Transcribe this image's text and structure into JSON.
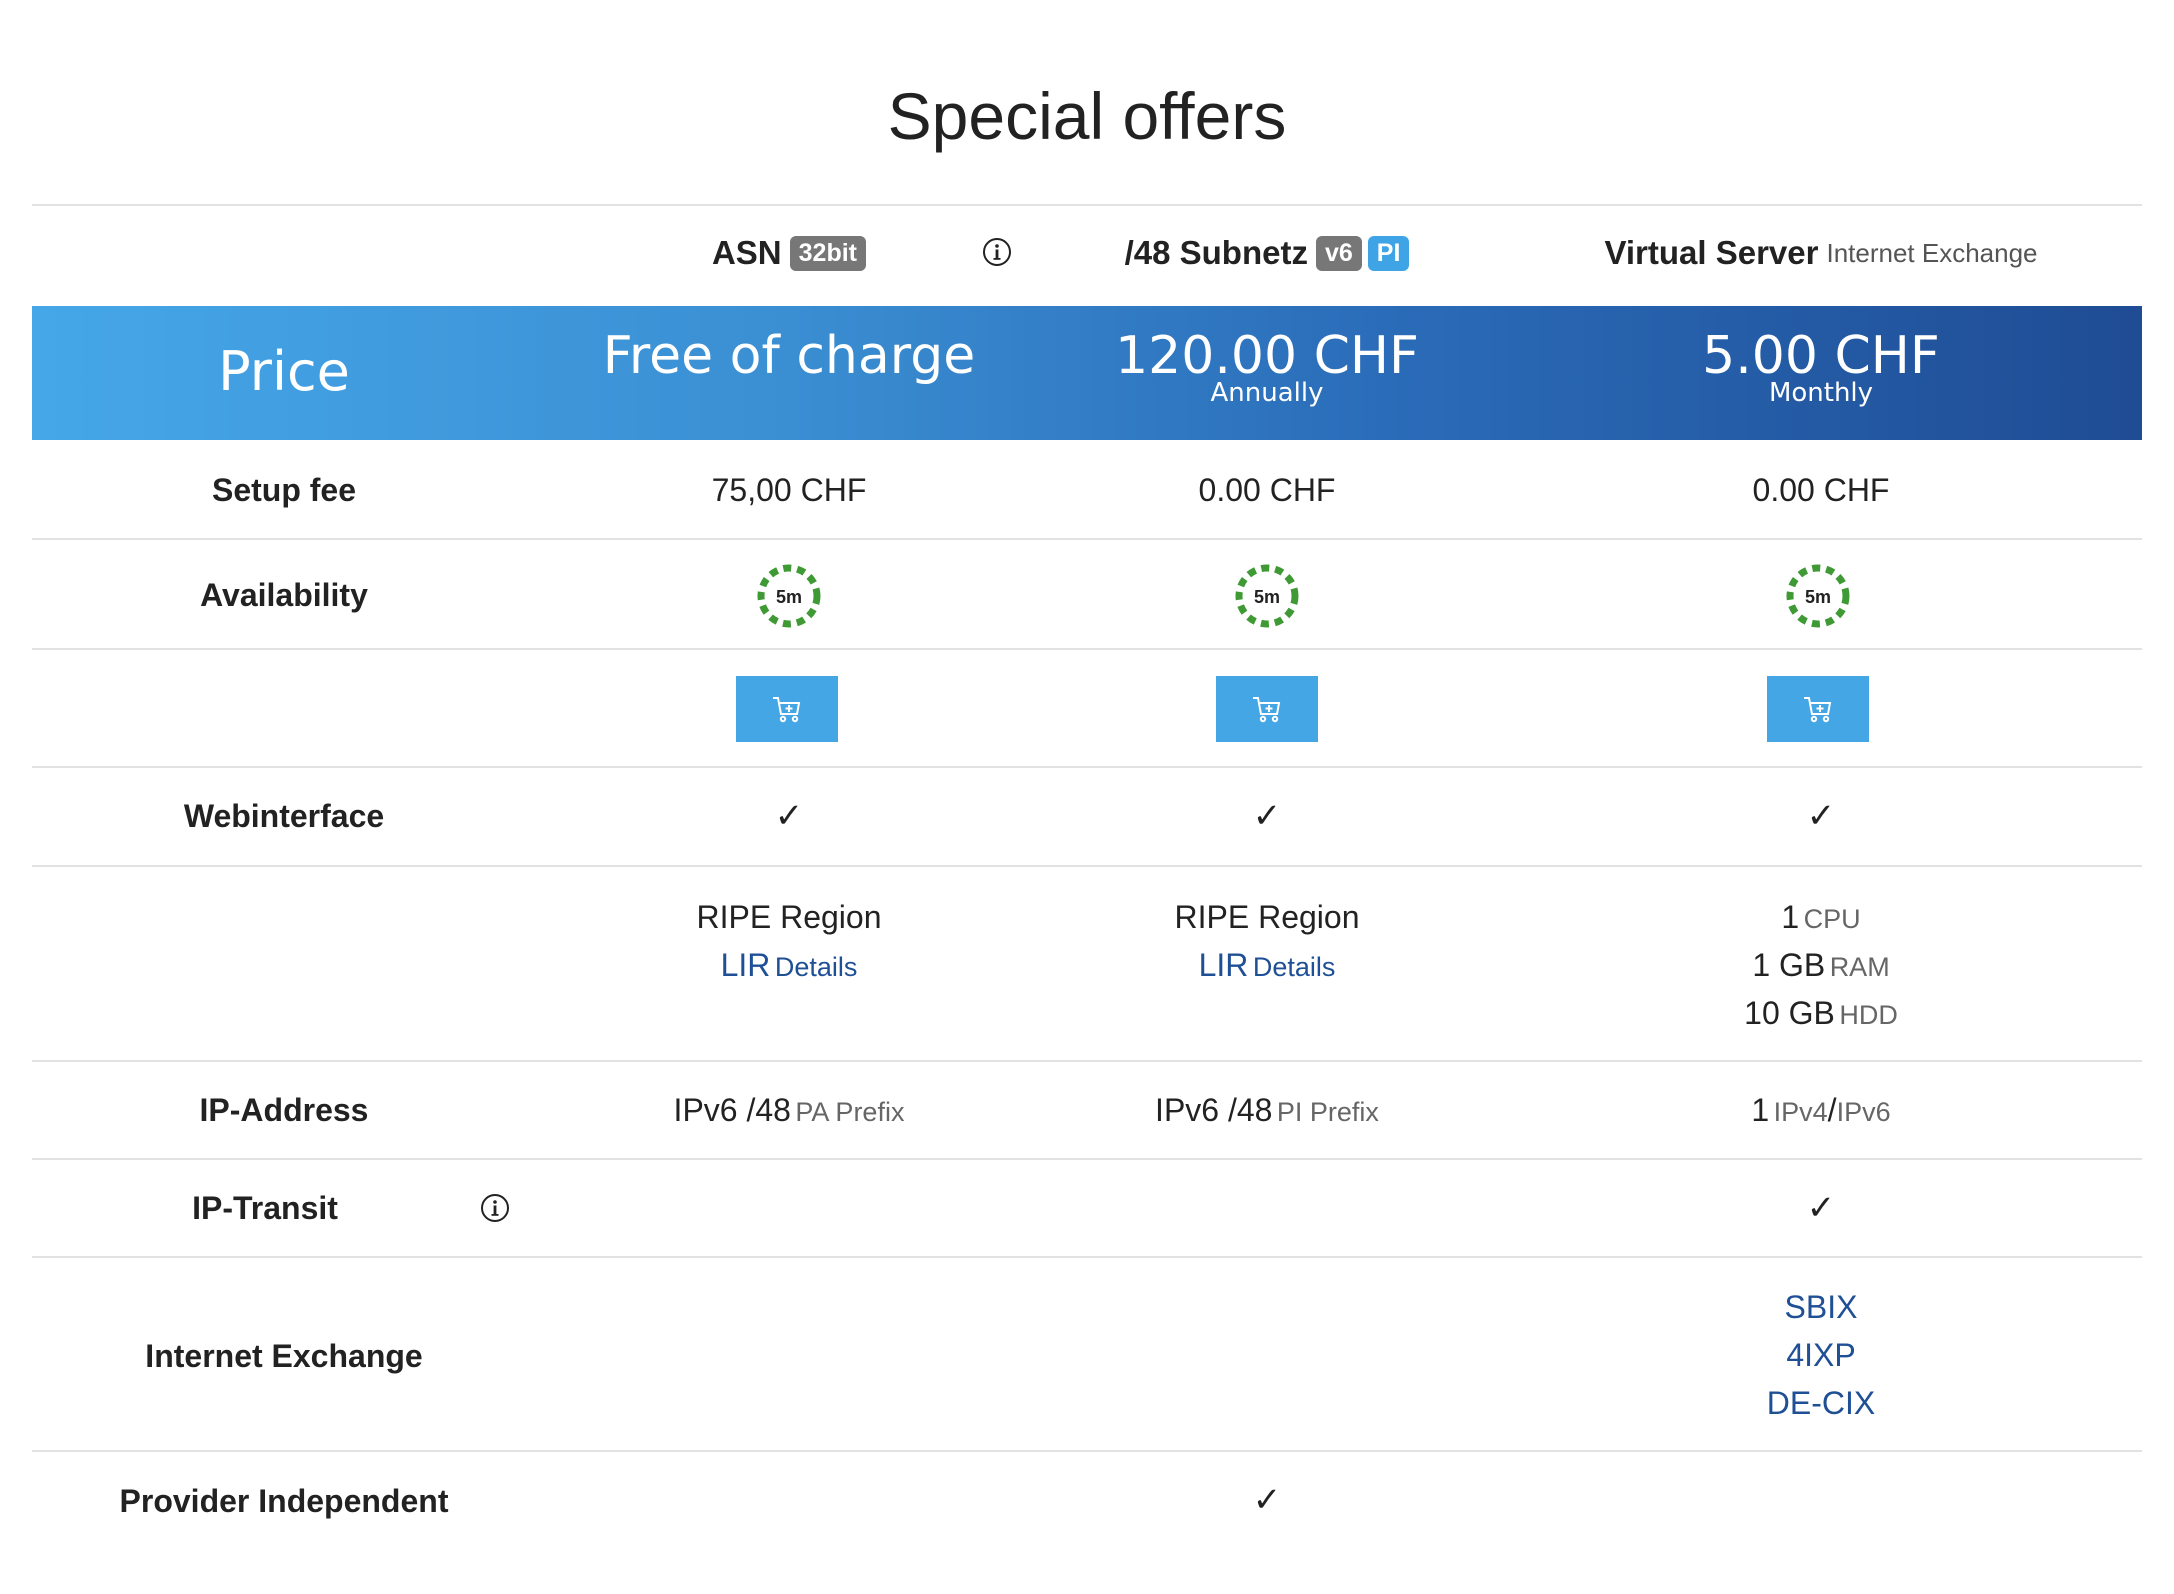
{
  "page": {
    "title": "Special offers"
  },
  "header": {
    "products": [
      {
        "name": "ASN",
        "badges": [
          "32bit"
        ]
      },
      {
        "name": "/48 Subnetz",
        "badges": [
          "v6",
          "PI"
        ]
      },
      {
        "name": "Virtual Server",
        "subtitle": "Internet Exchange"
      }
    ]
  },
  "price": {
    "label": "Price",
    "values": [
      {
        "main": "Free of charge",
        "sub": ""
      },
      {
        "main": "120.00 CHF",
        "sub": "Annually"
      },
      {
        "main": "5.00 CHF",
        "sub": "Monthly"
      }
    ]
  },
  "setup_fee": {
    "label": "Setup fee",
    "values": [
      "75,00 CHF",
      "0.00 CHF",
      "0.00 CHF"
    ]
  },
  "availability": {
    "label": "Availability",
    "icon_text": "5m",
    "icon_color": "#3f9a35"
  },
  "cart": {
    "icon": "cart-plus-icon",
    "color": "#45a6e6"
  },
  "webinterface": {
    "label": "Webinterface",
    "mark": "✓"
  },
  "details": {
    "asn": {
      "region": "RIPE Region",
      "lir": "LIR",
      "details": "Details"
    },
    "subnet": {
      "region": "RIPE Region",
      "lir": "LIR",
      "details": "Details"
    },
    "vs": [
      {
        "value": "1",
        "unit": "CPU"
      },
      {
        "value": "1 GB",
        "unit": "RAM"
      },
      {
        "value": "10 GB",
        "unit": "HDD"
      }
    ]
  },
  "ip_address": {
    "label": "IP-Address",
    "asn": {
      "value": "IPv6 /48",
      "unit": "PA Prefix"
    },
    "subnet": {
      "value": "IPv6 /48",
      "unit": "PI Prefix"
    },
    "vs": {
      "value": "1",
      "unit_a": "IPv4",
      "sep": "/",
      "unit_b": "IPv6"
    }
  },
  "ip_transit": {
    "label": "IP-Transit",
    "mark": "✓"
  },
  "internet_exchange": {
    "label": "Internet Exchange",
    "items": [
      "SBIX",
      "4IXP",
      "DE-CIX"
    ]
  },
  "provider_independent": {
    "label": "Provider Independent",
    "mark": "✓"
  },
  "colors": {
    "link": "#1f4f95",
    "band_start": "#45a7e8",
    "band_end": "#1f4c94"
  }
}
